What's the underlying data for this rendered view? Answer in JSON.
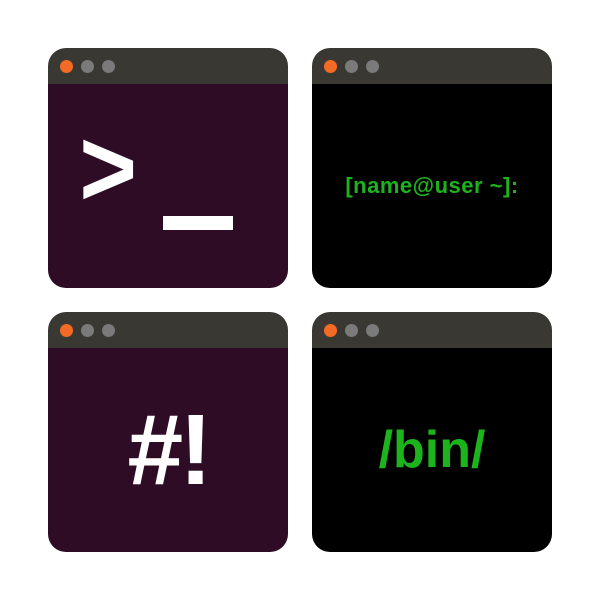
{
  "colors": {
    "titlebar": "#3a3833",
    "dot_close": "#f36a24",
    "dot_inactive": "#7a7a7a",
    "bg_purple": "#2e0c26",
    "bg_black": "#000000",
    "text_white": "#ffffff",
    "text_green": "#1db31d"
  },
  "windows": [
    {
      "id": "terminal-prompt",
      "bg": "purple",
      "text_color": "white",
      "prompt_symbol": ">",
      "has_cursor": true
    },
    {
      "id": "terminal-userhost",
      "bg": "black",
      "text_color": "green",
      "line": "[name@user ~]:"
    },
    {
      "id": "terminal-shebang",
      "bg": "purple",
      "text_color": "white",
      "line": "#!"
    },
    {
      "id": "terminal-bin",
      "bg": "black",
      "text_color": "green",
      "line": "/bin/"
    }
  ]
}
